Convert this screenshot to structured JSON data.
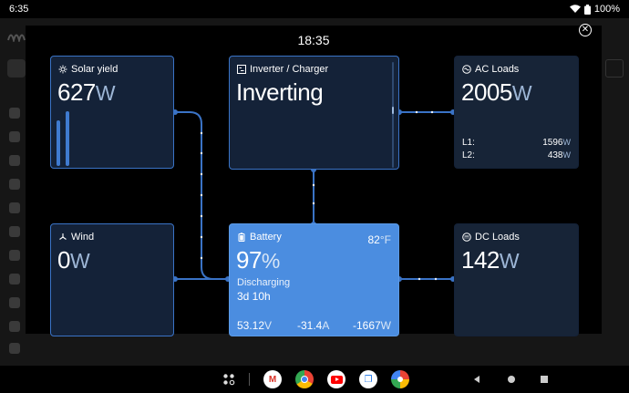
{
  "statusbar": {
    "time": "6:35",
    "battery": "100%"
  },
  "overlay": {
    "clock": "18:35"
  },
  "tiles": {
    "solar": {
      "title": "Solar yield",
      "value": "627",
      "unit": "W"
    },
    "inverter": {
      "title": "Inverter / Charger",
      "state": "Inverting"
    },
    "ac_loads": {
      "title": "AC Loads",
      "value": "2005",
      "unit": "W",
      "l1_label": "L1:",
      "l1_value": "1596",
      "l1_unit": "W",
      "l2_label": "L2:",
      "l2_value": "438",
      "l2_unit": "W"
    },
    "wind": {
      "title": "Wind",
      "value": "0",
      "unit": "W"
    },
    "battery": {
      "title": "Battery",
      "temperature": "82",
      "temp_unit": "°F",
      "soc": "97",
      "soc_unit": "%",
      "state": "Discharging",
      "time_to_go": "3d 10h",
      "voltage": "53.12",
      "voltage_unit": "V",
      "current": "-31.4",
      "current_unit": "A",
      "power": "-1667",
      "power_unit": "W"
    },
    "dc_loads": {
      "title": "DC Loads",
      "value": "142",
      "unit": "W"
    }
  },
  "colors": {
    "tile_bg": "#142238",
    "tile_border": "#3a73c6",
    "battery_bg": "#4b8de0",
    "wire": "#3a73c6"
  },
  "icons": {
    "solar": "sun-icon",
    "inverter": "inverter-icon",
    "ac": "ac-icon",
    "wind": "wind-turbine-icon",
    "battery": "battery-icon",
    "dc": "dc-icon",
    "close": "close-icon"
  }
}
